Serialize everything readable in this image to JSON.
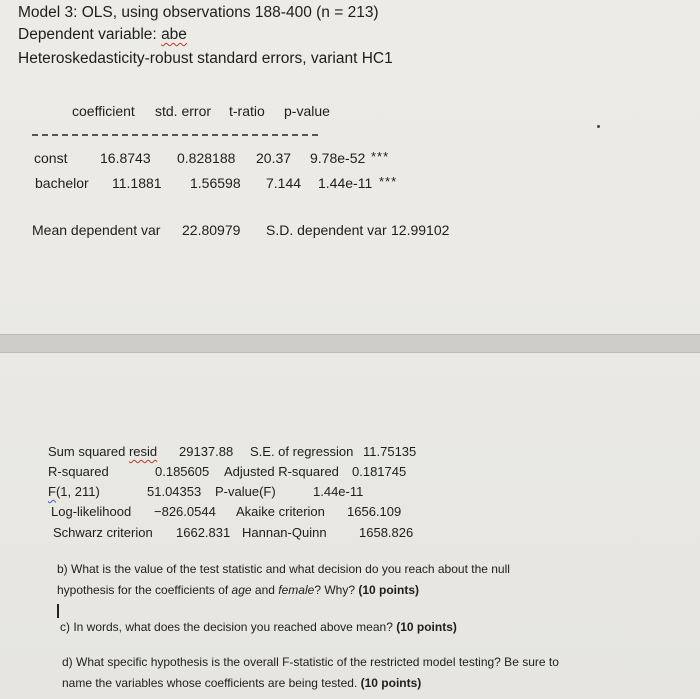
{
  "model": {
    "title": "Model 3: OLS, using observations 188-400 (n = 213)",
    "dependent_label": "Dependent variable:",
    "dependent_var": "abe",
    "se_note": "Heteroskedasticity-robust standard errors, variant HC1"
  },
  "table": {
    "headers": [
      "coefficient",
      "std. error",
      "t-ratio",
      "p-value"
    ],
    "rows": [
      {
        "name": "const",
        "coef": "16.8743",
        "se": "0.828188",
        "t": "20.37",
        "p": "9.78e-52",
        "sig": "***"
      },
      {
        "name": "bachelor",
        "coef": "11.1881",
        "se": "1.56598",
        "t": "7.144",
        "p": "1.44e-11",
        "sig": "***"
      }
    ]
  },
  "summary_top": {
    "mean_label": "Mean dependent var",
    "mean_value": "22.80979",
    "sd_label": "S.D. dependent var",
    "sd_value": "12.99102"
  },
  "stats": {
    "ssr_label": "Sum squared",
    "ssr_label2": "resid",
    "ssr_value": "29137.88",
    "ser_label": "S.E. of regression",
    "ser_value": "11.75135",
    "r2_label": "R-squared",
    "r2_value": "0.185605",
    "adjr2_label": "Adjusted R-squared",
    "adjr2_value": "0.181745",
    "f_label_f": "F",
    "f_label_rest": "(1, 211)",
    "f_value": "51.04353",
    "pf_label": "P-value(F)",
    "pf_value": "1.44e-11",
    "ll_label": "Log-likelihood",
    "ll_value": "−826.0544",
    "aic_label": "Akaike criterion",
    "aic_value": "1656.109",
    "bic_label": "Schwarz criterion",
    "bic_value": "1662.831",
    "hq_label": "Hannan-Quinn",
    "hq_value": "1658.826"
  },
  "questions": {
    "b_line1": "b) What is the value of the test statistic and what decision do you reach about the null",
    "b_line2_pre": "hypothesis for the coefficients of ",
    "b_var1": "age",
    "b_and": " and ",
    "b_var2": "female",
    "b_post": "? Why? ",
    "b_points": "(10 points)",
    "c_text": "c) In words, what does the decision you reached above mean? ",
    "c_points": "(10 points)",
    "d_line1": "d) What specific hypothesis is the overall F-statistic of the restricted model testing? Be sure to",
    "d_line2": "name the variables whose coefficients are being tested. ",
    "d_points": "(10 points)"
  }
}
